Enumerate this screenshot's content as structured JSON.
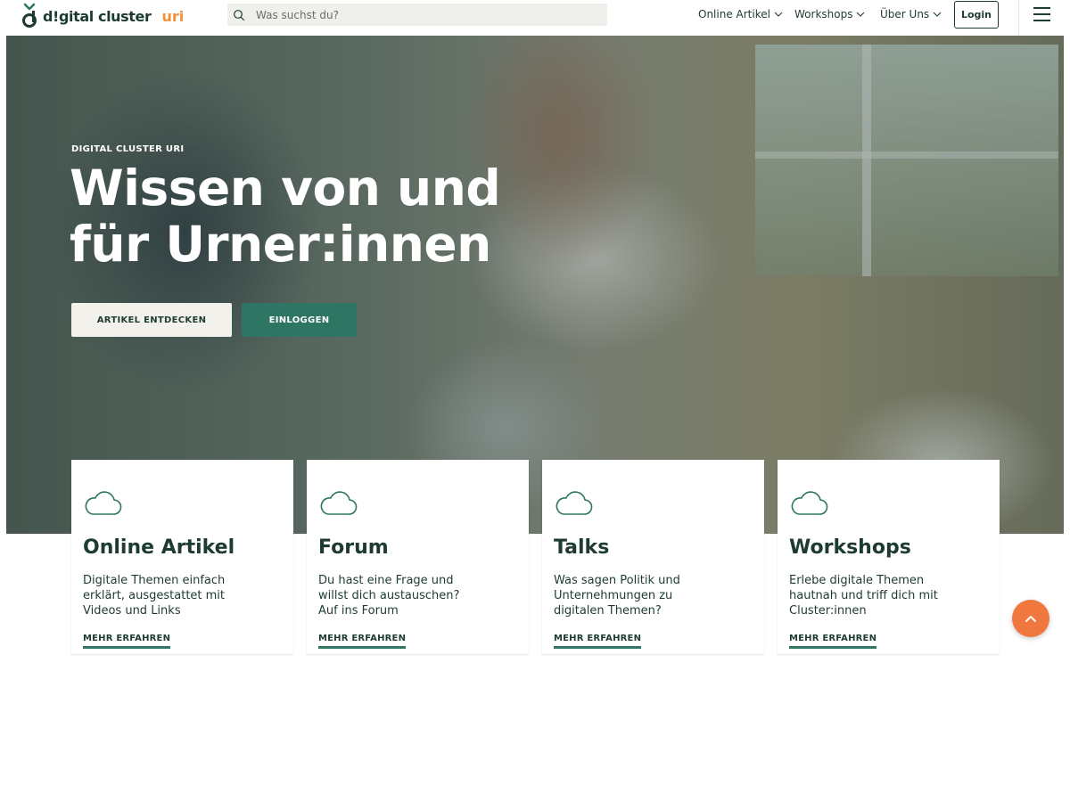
{
  "brand": {
    "name": "d!gital cluster",
    "accent": "uri",
    "primary_color": "#1d3b33",
    "accent_color": "#f0923a"
  },
  "search": {
    "placeholder": "Was suchst du?",
    "value": "",
    "icon": "search-icon"
  },
  "nav": {
    "items": [
      {
        "label": "Online Artikel",
        "icon": "chevron-down-icon"
      },
      {
        "label": "Workshops",
        "icon": "chevron-down-icon"
      },
      {
        "label": "Über Uns",
        "icon": "chevron-down-icon"
      }
    ],
    "login_label": "Login",
    "menu_icon": "hamburger-menu-icon"
  },
  "hero": {
    "eyebrow": "DIGITAL CLUSTER URI",
    "title": "Wissen von und für Urner:innen",
    "primary_button": "ARTIKEL ENTDECKEN",
    "secondary_button": "EINLOGGEN",
    "button_color": "#2e7564"
  },
  "cards": [
    {
      "icon": "cloud-icon",
      "title": "Online Artikel",
      "text": "Digitale Themen einfach\nerklärt, ausgestattet mit\nVideos und Links",
      "link": "MEHR ERFAHREN"
    },
    {
      "icon": "cloud-icon",
      "title": "Forum",
      "text": "Du hast eine Frage und\nwillst dich austauschen?\nAuf ins Forum",
      "link": "MEHR ERFAHREN"
    },
    {
      "icon": "cloud-icon",
      "title": "Talks",
      "text": "Was sagen Politik und\nUnternehmungen zu\ndigitalen Themen?",
      "link": "MEHR ERFAHREN"
    },
    {
      "icon": "cloud-icon",
      "title": "Workshops",
      "text": "Erlebe digitale Themen\nhautnah und triff dich mit\nCluster:innen",
      "link": "MEHR ERFAHREN"
    }
  ],
  "back_to_top": {
    "icon": "chevron-up-icon",
    "color": "#f0773e"
  }
}
